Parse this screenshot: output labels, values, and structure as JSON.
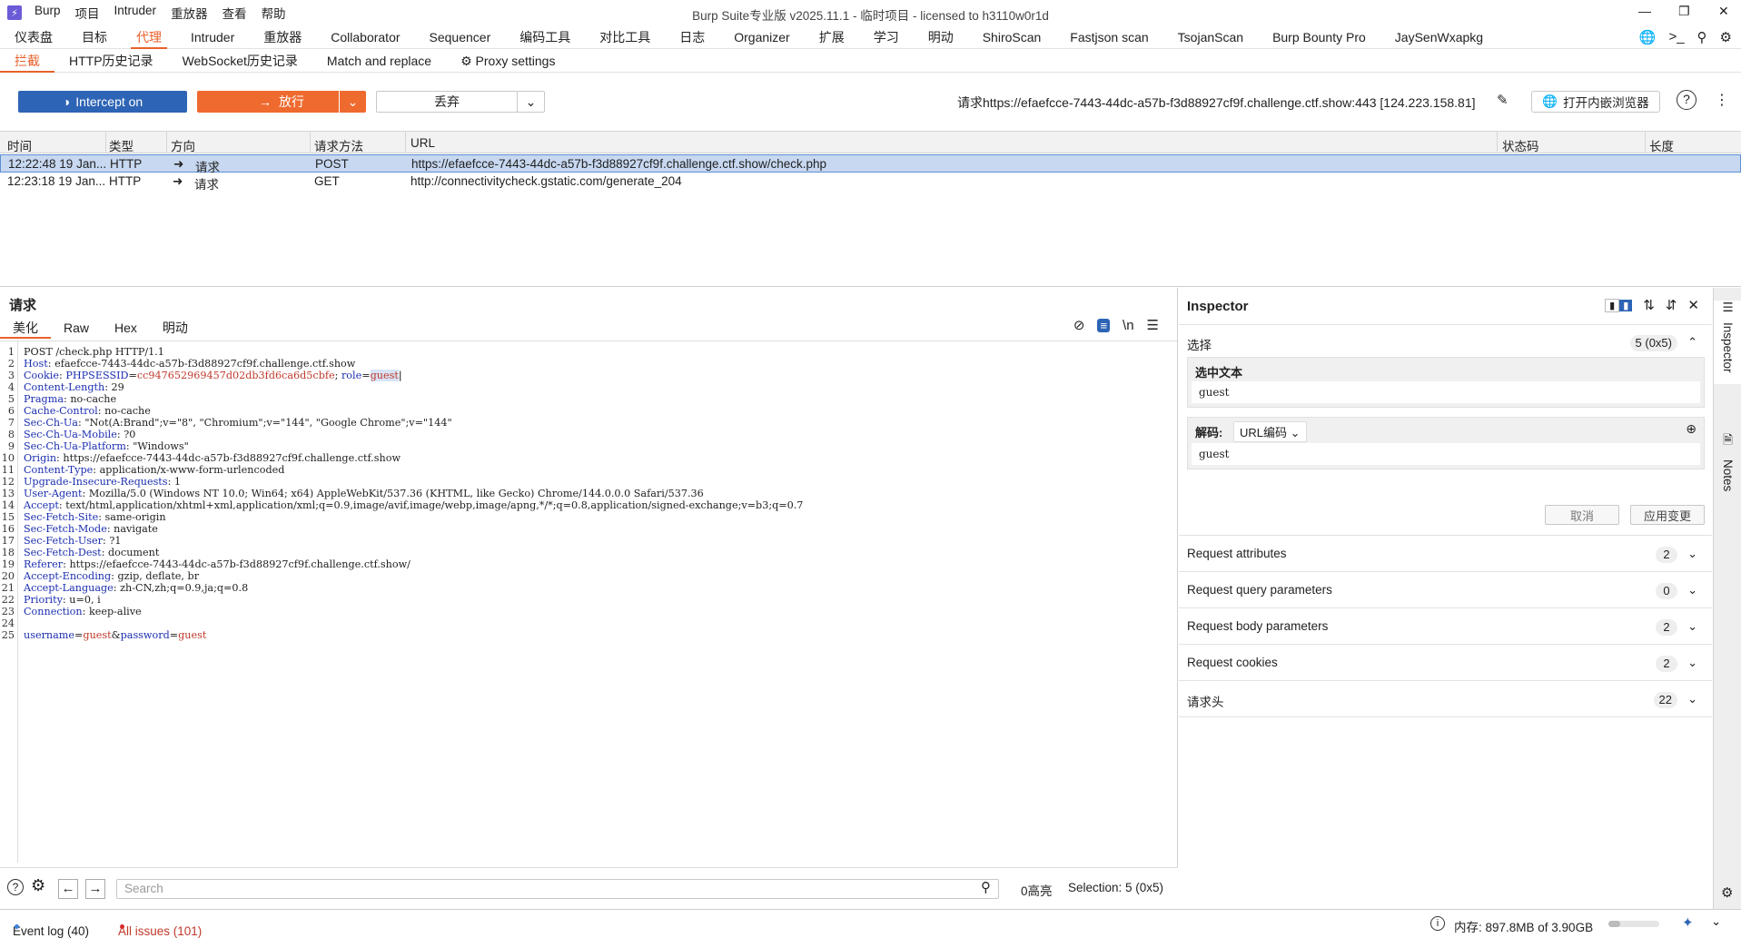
{
  "titlebar": {
    "logo": "⚡",
    "menus": [
      "Burp",
      "项目",
      "Intruder",
      "重放器",
      "查看",
      "帮助"
    ],
    "title": "Burp Suite专业版  v2025.11.1 - 临时项目 - licensed to h3110w0r1d"
  },
  "main_tabs": [
    "仪表盘",
    "目标",
    "代理",
    "Intruder",
    "重放器",
    "Collaborator",
    "Sequencer",
    "编码工具",
    "对比工具",
    "日志",
    "Organizer",
    "扩展",
    "学习",
    "明动",
    "ShiroScan",
    "Fastjson scan",
    "TsojanScan",
    "Burp Bounty Pro",
    "JaySenWxapkg"
  ],
  "proxy_tabs": [
    "拦截",
    "HTTP历史记录",
    "WebSocket历史记录",
    "Match and replace",
    "Proxy settings"
  ],
  "toolbar": {
    "intercept_label": "Intercept on",
    "forward_label": "放行",
    "drop_label": "丢弃",
    "request_info": "请求https://efaefcce-7443-44dc-a57b-f3d88927cf9f.challenge.ctf.show:443  [124.223.158.81]",
    "browser_label": "打开内嵌浏览器"
  },
  "grid": {
    "headers": [
      "时间",
      "类型",
      "方向",
      "请求方法",
      "URL",
      "状态码",
      "长度"
    ],
    "rows": [
      {
        "time": "12:22:48 19 Jan...",
        "type": "HTTP",
        "dir": "请求",
        "method": "POST",
        "url": "https://efaefcce-7443-44dc-a57b-f3d88927cf9f.challenge.ctf.show/check.php",
        "status": "",
        "length": ""
      },
      {
        "time": "12:23:18 19 Jan...",
        "type": "HTTP",
        "dir": "请求",
        "method": "GET",
        "url": "http://connectivitycheck.gstatic.com/generate_204",
        "status": "",
        "length": ""
      }
    ]
  },
  "request": {
    "title": "请求",
    "tabs": [
      "美化",
      "Raw",
      "Hex",
      "明动"
    ],
    "lines": [
      {
        "n": "1",
        "k": "",
        "v": "POST /check.php HTTP/1.1"
      },
      {
        "n": "2",
        "k": "Host",
        "v": " efaefcce-7443-44dc-a57b-f3d88927cf9f.challenge.ctf.show"
      },
      {
        "n": "3",
        "k": "Cookie",
        "v": " PHPSESSID=cc947652969457d02db3fd6ca6d5cbfe; role=guest"
      },
      {
        "n": "4",
        "k": "Content-Length",
        "v": " 29"
      },
      {
        "n": "5",
        "k": "Pragma",
        "v": " no-cache"
      },
      {
        "n": "6",
        "k": "Cache-Control",
        "v": " no-cache"
      },
      {
        "n": "7",
        "k": "Sec-Ch-Ua",
        "v": " \"Not(A:Brand\";v=\"8\", \"Chromium\";v=\"144\", \"Google Chrome\";v=\"144\""
      },
      {
        "n": "8",
        "k": "Sec-Ch-Ua-Mobile",
        "v": " ?0"
      },
      {
        "n": "9",
        "k": "Sec-Ch-Ua-Platform",
        "v": " \"Windows\""
      },
      {
        "n": "10",
        "k": "Origin",
        "v": " https://efaefcce-7443-44dc-a57b-f3d88927cf9f.challenge.ctf.show"
      },
      {
        "n": "11",
        "k": "Content-Type",
        "v": " application/x-www-form-urlencoded"
      },
      {
        "n": "12",
        "k": "Upgrade-Insecure-Requests",
        "v": " 1"
      },
      {
        "n": "13",
        "k": "User-Agent",
        "v": " Mozilla/5.0 (Windows NT 10.0; Win64; x64) AppleWebKit/537.36 (KHTML, like Gecko) Chrome/144.0.0.0 Safari/537.36"
      },
      {
        "n": "14",
        "k": "Accept",
        "v": " text/html,application/xhtml+xml,application/xml;q=0.9,image/avif,image/webp,image/apng,*/*;q=0.8,application/signed-exchange;v=b3;q=0.7"
      },
      {
        "n": "15",
        "k": "Sec-Fetch-Site",
        "v": " same-origin"
      },
      {
        "n": "16",
        "k": "Sec-Fetch-Mode",
        "v": " navigate"
      },
      {
        "n": "17",
        "k": "Sec-Fetch-User",
        "v": " ?1"
      },
      {
        "n": "18",
        "k": "Sec-Fetch-Dest",
        "v": " document"
      },
      {
        "n": "19",
        "k": "Referer",
        "v": " https://efaefcce-7443-44dc-a57b-f3d88927cf9f.challenge.ctf.show/"
      },
      {
        "n": "20",
        "k": "Accept-Encoding",
        "v": " gzip, deflate, br"
      },
      {
        "n": "21",
        "k": "Accept-Language",
        "v": " zh-CN,zh;q=0.9,ja;q=0.8"
      },
      {
        "n": "22",
        "k": "Priority",
        "v": " u=0, i"
      },
      {
        "n": "23",
        "k": "Connection",
        "v": " keep-alive"
      },
      {
        "n": "24",
        "k": "",
        "v": ""
      },
      {
        "n": "25",
        "k": "",
        "v": "username=guest&password=guest"
      }
    ]
  },
  "search": {
    "placeholder": "Search",
    "highlights": "0高亮",
    "selection": "Selection: 5 (0x5)"
  },
  "inspector": {
    "title": "Inspector",
    "selection_label": "选择",
    "selection_count": "5 (0x5)",
    "selected_text_label": "选中文本",
    "selected_text": "guest",
    "decode_label": "解码:",
    "decode_type": "URL编码",
    "decoded_text": "guest",
    "cancel_label": "取消",
    "apply_label": "应用变更",
    "sections": [
      {
        "label": "Request attributes",
        "count": "2"
      },
      {
        "label": "Request query parameters",
        "count": "0"
      },
      {
        "label": "Request body parameters",
        "count": "2"
      },
      {
        "label": "Request cookies",
        "count": "2"
      },
      {
        "label": "请求头",
        "count": "22"
      }
    ]
  },
  "rail": {
    "inspector": "Inspector",
    "notes": "Notes"
  },
  "status": {
    "event_log": "Event log (40)",
    "issues": "All issues (101)",
    "memory": "内存: 897.8MB of 3.90GB"
  },
  "colors": {
    "accent": "#e8612c",
    "intercept": "#2d64b5",
    "forward": "#ef6a2f",
    "selected_row": "#c7d8f0"
  }
}
